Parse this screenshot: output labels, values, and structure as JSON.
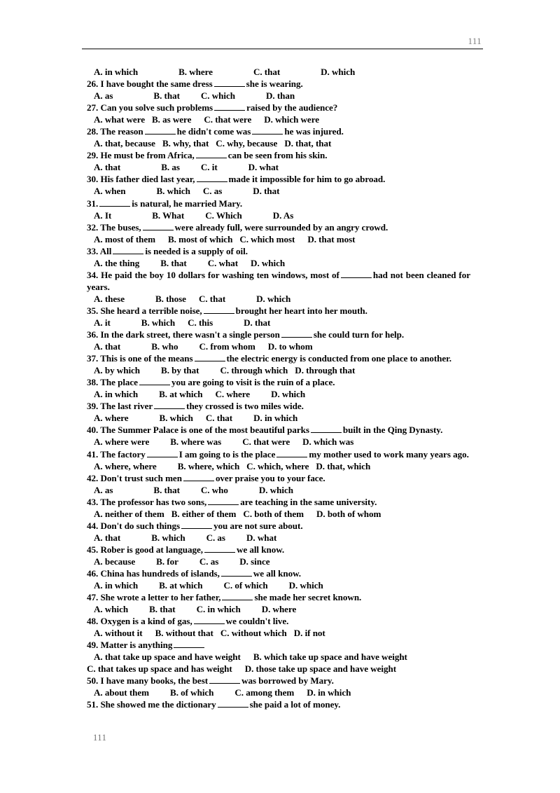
{
  "header": {
    "page_number": "111"
  },
  "footer": {
    "page_number": "111"
  },
  "document": {
    "orphan_options_line": {
      "a": "A. in which",
      "b": "B. where",
      "c": "C. that",
      "d": "D. which"
    },
    "questions": [
      {
        "number": "26.",
        "text_before": "26. I have bought the same dress",
        "text_after": "she is wearing.",
        "multiline": false,
        "options": {
          "a": "A. as",
          "b": "B. that",
          "c": "C. which",
          "d": "D. than"
        }
      },
      {
        "number": "27.",
        "text_before": "27. Can you solve such problems",
        "text_after": "raised by the audience?",
        "multiline": false,
        "options": {
          "a": "A. what were",
          "b": "B. as were",
          "c": "C. that were",
          "d": "D. which were"
        }
      },
      {
        "number": "28.",
        "text_before": "28. The reason",
        "text_mid": "he didn't come was",
        "text_after": "he was injured.",
        "multiline": false,
        "two_blanks": true,
        "options": {
          "a": "A. that, because",
          "b": "B. why, that",
          "c": "C. why, because",
          "d": "D. that, that"
        }
      },
      {
        "number": "29.",
        "text_before": "29. He must be from Africa,",
        "text_after": "can be seen from his skin.",
        "multiline": false,
        "options": {
          "a": "A. that",
          "b": "B. as",
          "c": "C. it",
          "d": "D. what"
        }
      },
      {
        "number": "30.",
        "text_before": "30. His father died last year,",
        "text_after": "made it impossible for him to go abroad.",
        "multiline": false,
        "options": {
          "a": "A. when",
          "b": "B. which",
          "c": "C. as",
          "d": "D. that"
        }
      },
      {
        "number": "31.",
        "text_before": "31.",
        "text_after": "is natural, he married Mary.",
        "multiline": false,
        "options": {
          "a": "A. It",
          "b": "B. What",
          "c": "C. Which",
          "d": "D. As"
        }
      },
      {
        "number": "32.",
        "text_before": "32. The buses,",
        "text_after": "were already full, were surrounded by an angry crowd.",
        "multiline": false,
        "options": {
          "a": "A. most of them",
          "b": "B. most of which",
          "c": "C. which most",
          "d": "D. that most"
        }
      },
      {
        "number": "33.",
        "text_before": "33. All",
        "text_after": "is needed is a supply of oil.",
        "multiline": false,
        "options": {
          "a": "A. the thing",
          "b": "B. that",
          "c": "C. what",
          "d": "D. which"
        }
      },
      {
        "number": "34.",
        "text_before": "34. He paid the boy 10 dollars for washing ten windows, most of",
        "text_after": "had not been cleaned for years.",
        "multiline": true,
        "options": {
          "a": "A. these",
          "b": "B. those",
          "c": "C. that",
          "d": "D. which"
        }
      },
      {
        "number": "35.",
        "text_before": "35. She heard a terrible noise,",
        "text_after": "brought her heart into her mouth.",
        "multiline": false,
        "options": {
          "a": "A. it",
          "b": "B. which",
          "c": "C. this",
          "d": "D. that"
        }
      },
      {
        "number": "36.",
        "text_before": "36. In the dark street, there wasn't a single person",
        "text_after": "she could turn for help.",
        "multiline": false,
        "options": {
          "a": "A. that",
          "b": "B. who",
          "c": "C. from whom",
          "d": "D. to whom"
        }
      },
      {
        "number": "37.",
        "text_before": "37. This is one of the means",
        "text_after": "the electric energy is conducted from one place to another.",
        "multiline": true,
        "options": {
          "a": "A. by which",
          "b": "B. by that",
          "c": "C. through which",
          "d": "D. through that"
        }
      },
      {
        "number": "38.",
        "text_before": "38. The place",
        "text_after": "you are going to visit is the ruin of a place.",
        "multiline": false,
        "options": {
          "a": "A. in which",
          "b": "B. at which",
          "c": "C. where",
          "d": "D. which"
        }
      },
      {
        "number": "39.",
        "text_before": "39. The last river",
        "text_after": "they crossed is two miles wide.",
        "multiline": false,
        "options": {
          "a": "A. where",
          "b": "B. which",
          "c": "C. that",
          "d": "D. in which"
        }
      },
      {
        "number": "40.",
        "text_before": "40. The Summer Palace is one of the most beautiful parks",
        "text_after": "built in the Qing Dynasty.",
        "multiline": true,
        "options": {
          "a": "A. where were",
          "b": "B. where was",
          "c": "C. that were",
          "d": "D. which was"
        }
      },
      {
        "number": "41.",
        "text_before": "41. The factory",
        "text_mid": "I am going to is the place",
        "text_after": "my mother used to work many years ago.",
        "multiline": true,
        "two_blanks": true,
        "options": {
          "a": "A. where, where",
          "b": "B. where, which",
          "c": "C. which, where",
          "d": "D. that, which"
        }
      },
      {
        "number": "42.",
        "text_before": "42. Don't trust such men",
        "text_after": "over praise you to your face.",
        "multiline": false,
        "options": {
          "a": "A. as",
          "b": "B. that",
          "c": "C. who",
          "d": "D. which"
        }
      },
      {
        "number": "43.",
        "text_before": "43. The professor has two sons,",
        "text_after": "are teaching in the same university.",
        "multiline": false,
        "options": {
          "a": "A. neither of them",
          "b": "B. either of them",
          "c": "C. both of them",
          "d": "D. both of whom"
        }
      },
      {
        "number": "44.",
        "text_before": "44. Don't do such things",
        "text_after": "you are not sure about.",
        "multiline": false,
        "options": {
          "a": "A. that",
          "b": "B. which",
          "c": "C. as",
          "d": "D. what"
        }
      },
      {
        "number": "45.",
        "text_before": "45. Rober is good at language,",
        "text_after": "we all know.",
        "multiline": false,
        "options": {
          "a": "A. because",
          "b": "B. for",
          "c": "C. as",
          "d": "D. since"
        }
      },
      {
        "number": "46.",
        "text_before": "46. China has hundreds of islands,",
        "text_after": "we all know.",
        "multiline": false,
        "options": {
          "a": "A. in which",
          "b": "B. at which",
          "c": "C. of which",
          "d": "D. which"
        }
      },
      {
        "number": "47.",
        "text_before": "47. She wrote a letter to her father,",
        "text_after": "she made her secret known.",
        "multiline": false,
        "options": {
          "a": "A. which",
          "b": "B. that",
          "c": "C. in which",
          "d": "D. where"
        }
      },
      {
        "number": "48.",
        "text_before": "48. Oxygen is a kind of gas,",
        "text_after": "we couldn't live.",
        "multiline": false,
        "options": {
          "a": "A. without it",
          "b": "B. without that",
          "c": "C. without which",
          "d": "D. if not"
        }
      },
      {
        "number": "49.",
        "text_before": "49. Matter is anything",
        "text_after": "",
        "multiline": false,
        "options_two_rows": true,
        "options": {
          "a": "A. that take up space and have weight",
          "b": "B. which take up space and have weight",
          "c": "C. that takes up space and has weight",
          "d": "D. those take up space and have weight"
        }
      },
      {
        "number": "50.",
        "text_before": "50. I have many books, the best",
        "text_after": "was borrowed by Mary.",
        "multiline": false,
        "options": {
          "a": "A. about them",
          "b": "B. of which",
          "c": "C. among them",
          "d": "D. in which"
        }
      },
      {
        "number": "51.",
        "text_before": "51. She showed me the dictionary",
        "text_after": "she paid a lot of money.",
        "multiline": false,
        "no_options": true,
        "options": {
          "a": "",
          "b": "",
          "c": "",
          "d": ""
        }
      }
    ]
  }
}
